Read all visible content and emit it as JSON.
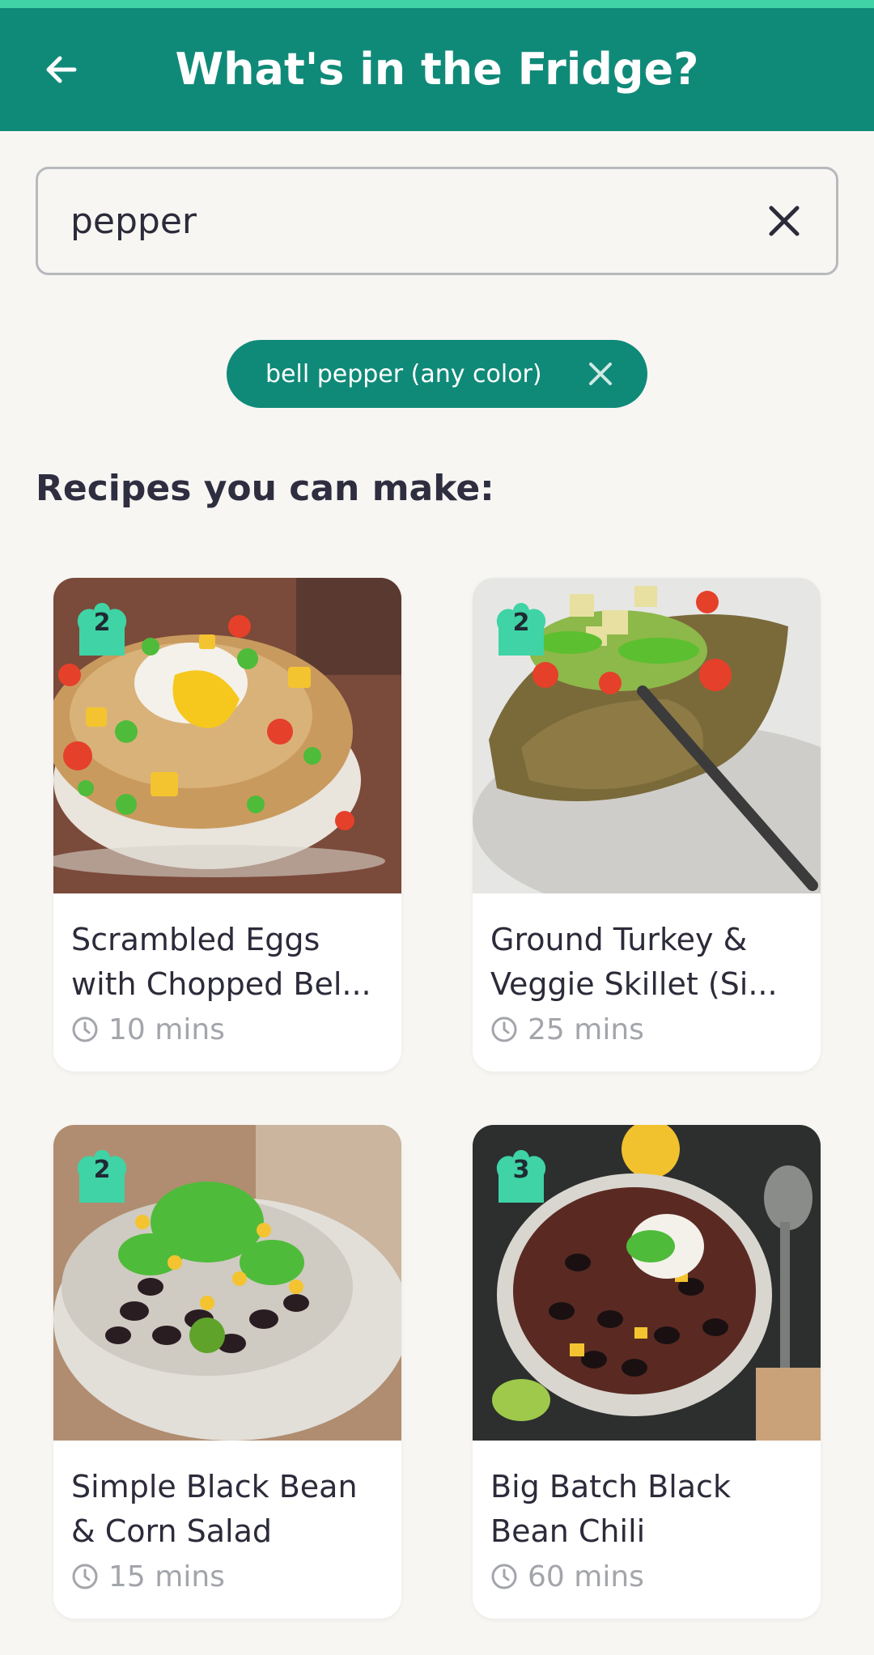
{
  "header": {
    "title": "What's in the Fridge?"
  },
  "search": {
    "value": "pepper"
  },
  "chip": {
    "label": "bell pepper (any color)"
  },
  "section": {
    "title": "Recipes you can make:"
  },
  "recipes": [
    {
      "line1": "Scrambled Eggs",
      "line2": "with Chopped Bel...",
      "time": "10 mins",
      "badge": "2"
    },
    {
      "line1": "Ground Turkey &",
      "line2": "Veggie Skillet (Si...",
      "time": "25 mins",
      "badge": "2"
    },
    {
      "line1": "Simple Black Bean",
      "line2": "& Corn Salad",
      "time": "15 mins",
      "badge": "2"
    },
    {
      "line1": "Big Batch Black",
      "line2": "Bean Chili",
      "time": "60 mins",
      "badge": "3"
    }
  ],
  "colors": {
    "primary": "#108a78",
    "accent": "#3fd3a6",
    "background": "#f7f6f3"
  },
  "icons": {
    "back": "arrow-left-icon",
    "clear": "close-icon",
    "time": "clock-icon",
    "badge": "chef-hat-icon"
  }
}
